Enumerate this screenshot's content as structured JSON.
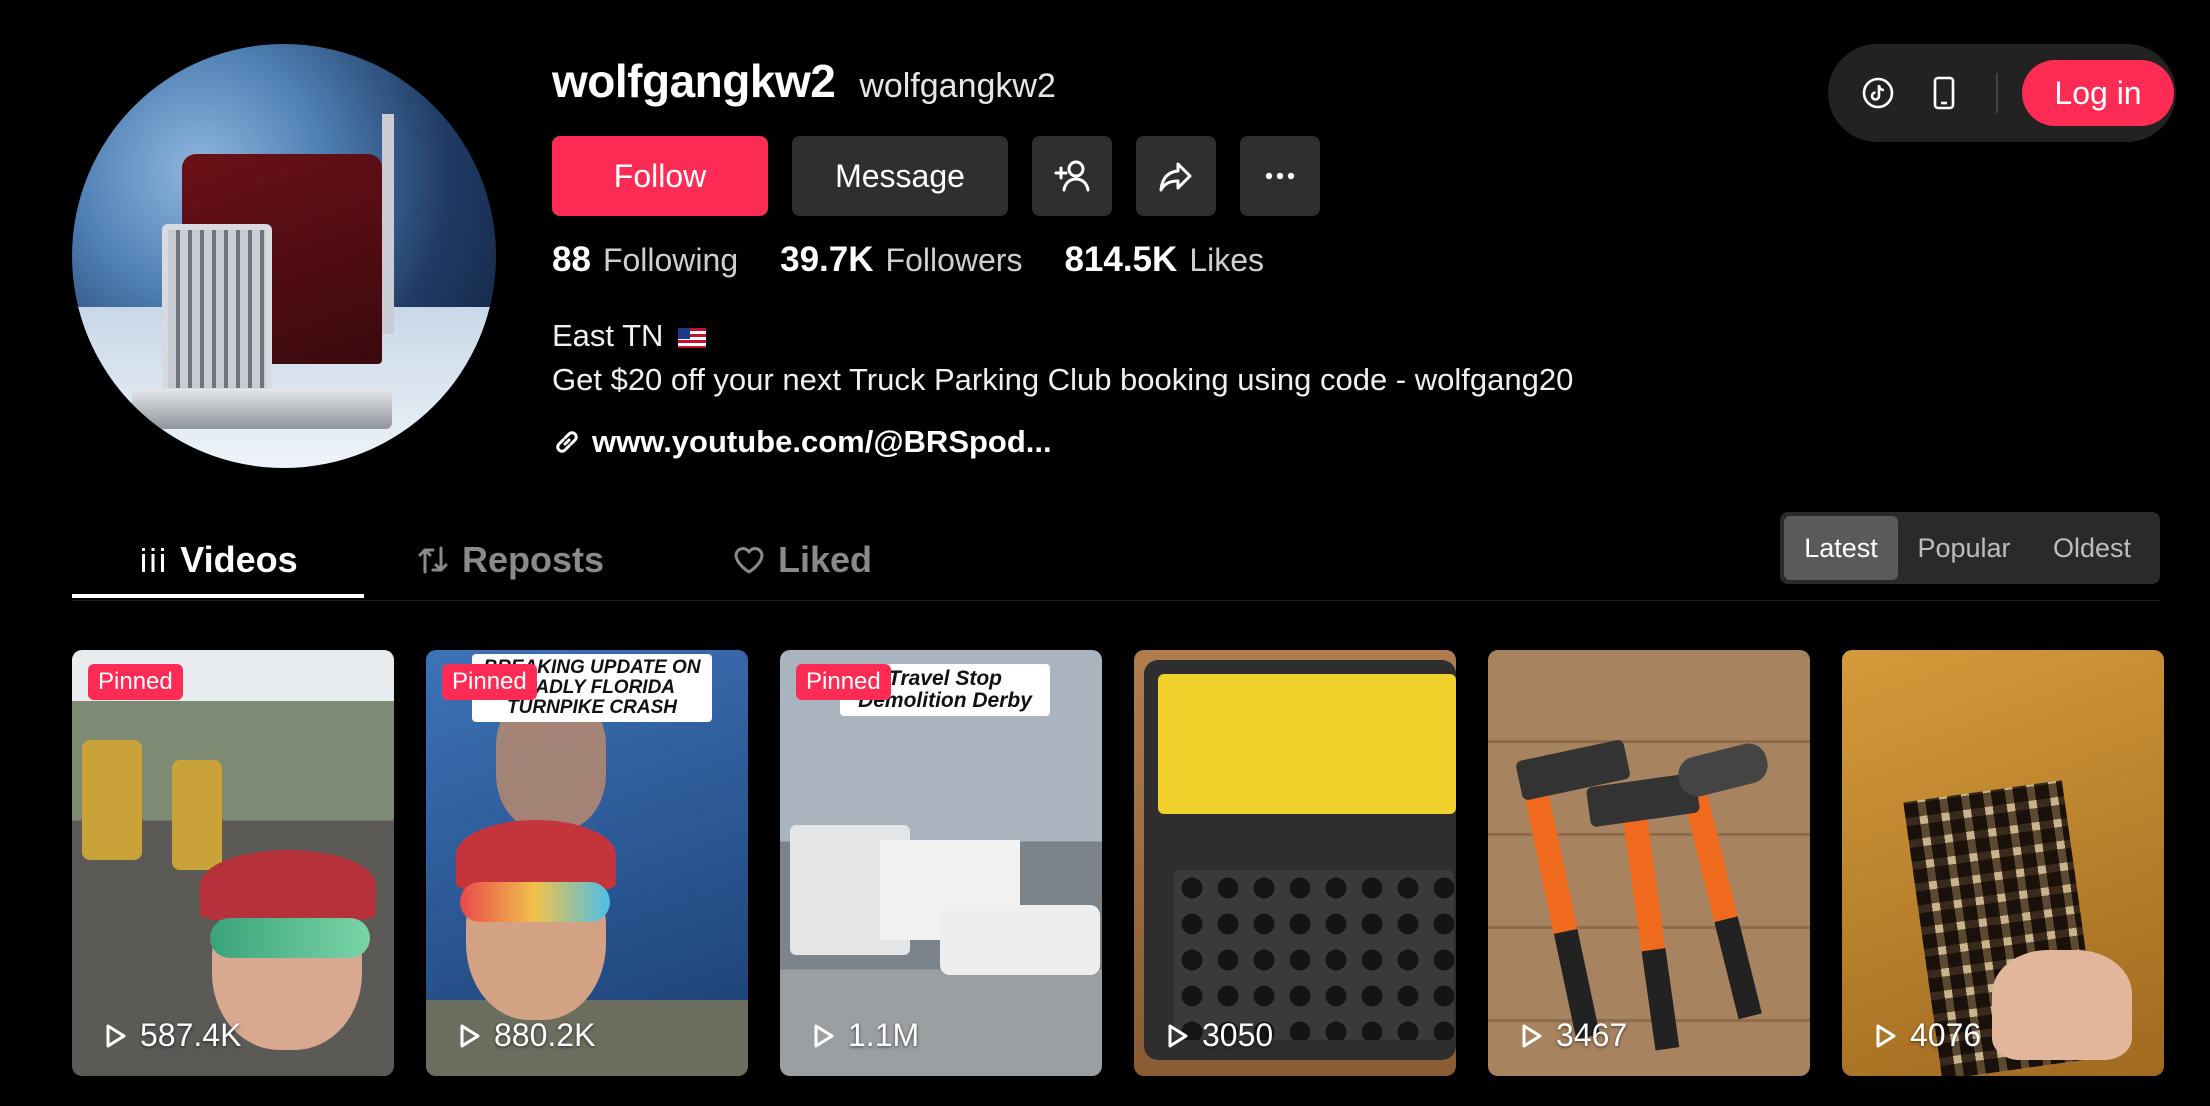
{
  "profile": {
    "username": "wolfgangkw2",
    "nickname": "wolfgangkw2",
    "bio_line1": "East TN",
    "bio_line2": "Get $20 off your next Truck Parking Club booking using code - wolfgang20",
    "link": "www.youtube.com/@BRSpod..."
  },
  "actions": {
    "follow_label": "Follow",
    "message_label": "Message"
  },
  "stats": [
    {
      "value": "88",
      "label": "Following"
    },
    {
      "value": "39.7K",
      "label": "Followers"
    },
    {
      "value": "814.5K",
      "label": "Likes"
    }
  ],
  "topbar": {
    "login_label": "Log in"
  },
  "tabs": [
    {
      "label": "Videos",
      "icon": "grid-bars-icon",
      "active": true
    },
    {
      "label": "Reposts",
      "icon": "repost-icon",
      "active": false
    },
    {
      "label": "Liked",
      "icon": "heart-outline-icon",
      "active": false
    }
  ],
  "sort": {
    "options": [
      "Latest",
      "Popular",
      "Oldest"
    ],
    "selected": "Latest"
  },
  "videos": [
    {
      "views": "587.4K",
      "pinned": "Pinned",
      "caption": ""
    },
    {
      "views": "880.2K",
      "pinned": "Pinned",
      "caption": "BREAKING UPDATE ON DEADLY FLORIDA TURNPIKE CRASH"
    },
    {
      "views": "1.1M",
      "pinned": "Pinned",
      "caption": "Travel Stop Demolition Derby"
    },
    {
      "views": "3050",
      "pinned": "",
      "caption": ""
    },
    {
      "views": "3467",
      "pinned": "",
      "caption": ""
    },
    {
      "views": "4076",
      "pinned": "",
      "caption": ""
    }
  ],
  "colors": {
    "accent": "#fe2c55",
    "background": "#000000",
    "button_dark": "#2f2f2f"
  }
}
